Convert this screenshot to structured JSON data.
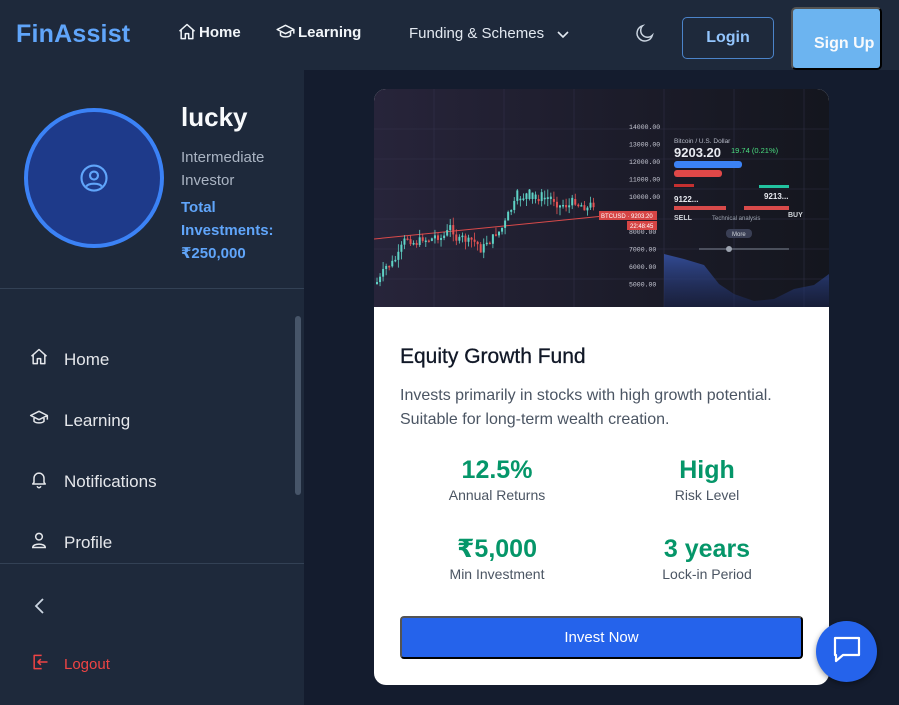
{
  "brand": "FinAssist",
  "nav": {
    "home": "Home",
    "learning": "Learning",
    "funding": "Funding & Schemes",
    "login": "Login",
    "signup": "Sign Up"
  },
  "icons": {
    "home": "home-icon",
    "learning": "graduation-cap-icon",
    "chevron": "chevron-down-icon",
    "theme": "moon-icon",
    "notifications": "bell-icon",
    "profile": "user-icon",
    "collapse": "chevron-left-icon",
    "logout": "logout-icon",
    "chat": "chat-bubble-icon"
  },
  "user": {
    "name": "lucky",
    "level": "Intermediate Investor",
    "investments": "Total Investments: ₹250,000"
  },
  "sidebar": {
    "items": [
      {
        "label": "Home"
      },
      {
        "label": "Learning"
      },
      {
        "label": "Notifications"
      },
      {
        "label": "Profile"
      }
    ],
    "logout": "Logout"
  },
  "fund": {
    "title": "Equity Growth Fund",
    "description": "Invests primarily in stocks with high growth potential. Suitable for long-term wealth creation.",
    "stats": [
      {
        "value": "12.5%",
        "label": "Annual Returns"
      },
      {
        "value": "High",
        "label": "Risk Level"
      },
      {
        "value": "₹5,000",
        "label": "Min Investment"
      },
      {
        "value": "3 years",
        "label": "Lock-in Period"
      }
    ],
    "cta": "Invest Now",
    "image_price_labels": [
      "9203.20",
      "19.74 (0.21%)",
      "Bitcoin / U.S. Dollar",
      "BTCUSD",
      "9122...",
      "9213...",
      "SELL",
      "BUY"
    ],
    "image_axis_labels": [
      "14000.00",
      "13000.00",
      "12000.00",
      "11000.00",
      "10000.00",
      "9000.00",
      "8000.00",
      "7000.00",
      "6000.00",
      "5000.00"
    ]
  },
  "colors": {
    "background": "#141c2e",
    "panel": "#1e293b",
    "brand": "#60a5fa",
    "accent": "#2563eb",
    "positive": "#059669",
    "danger": "#ef4444"
  }
}
